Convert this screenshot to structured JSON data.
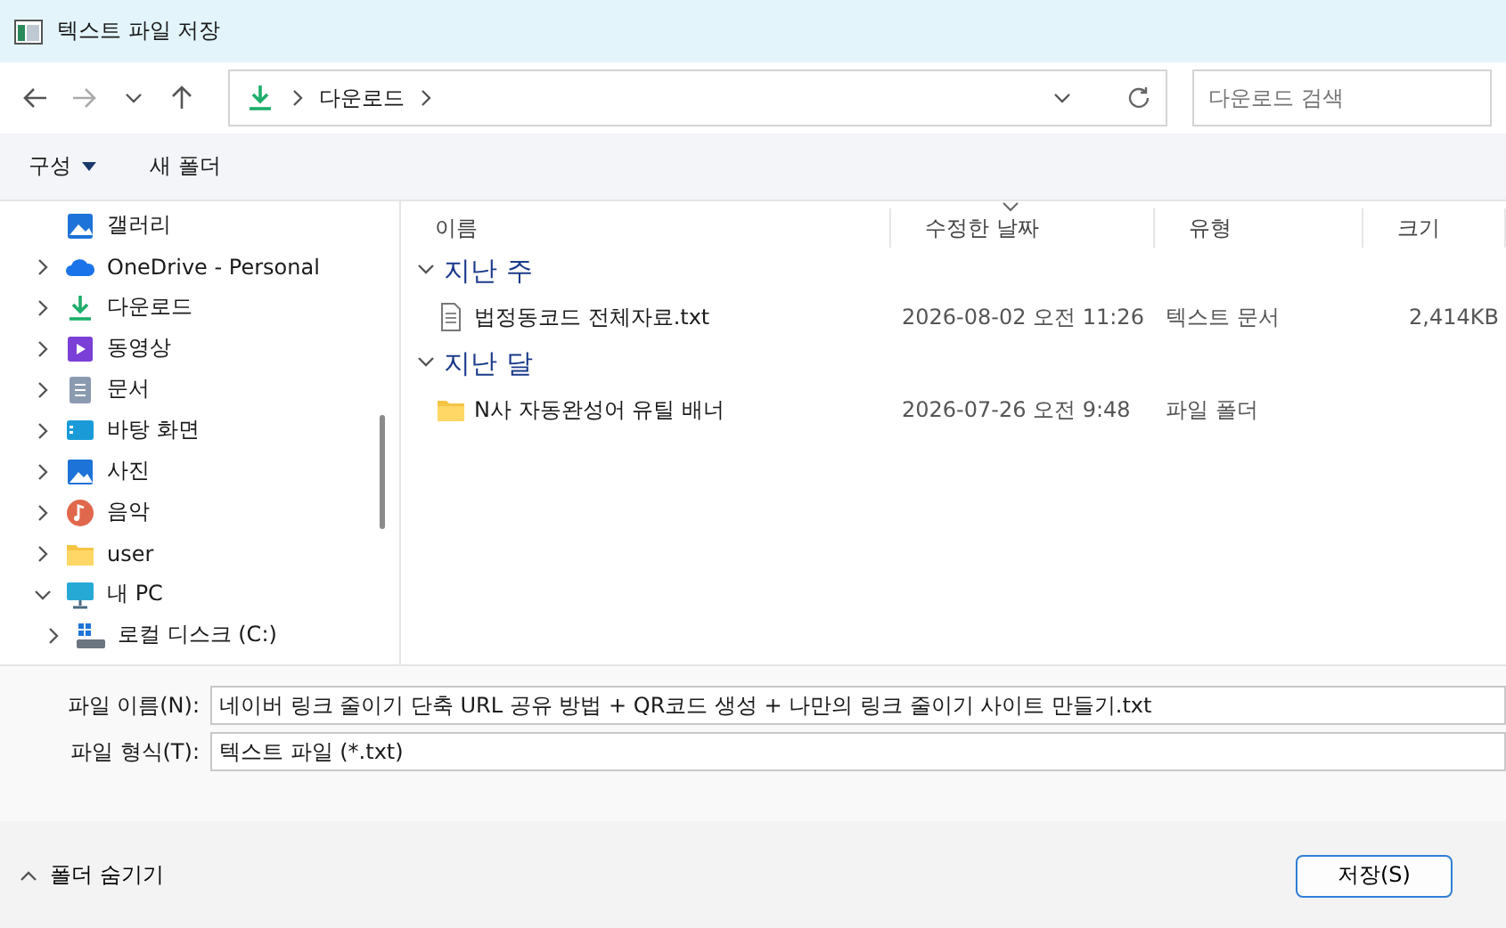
{
  "window": {
    "title": "텍스트 파일 저장"
  },
  "address_bar": {
    "path": [
      "다운로드"
    ]
  },
  "search": {
    "placeholder": "다운로드 검색"
  },
  "command_bar": {
    "organize": "구성",
    "new_folder": "새 폴더"
  },
  "sidebar": {
    "items": [
      {
        "label": "갤러리",
        "kind": "gallery"
      },
      {
        "label": "OneDrive - Personal",
        "kind": "cloud",
        "expanded": false
      },
      {
        "label": "다운로드",
        "kind": "download",
        "expanded": false
      },
      {
        "label": "동영상",
        "kind": "video",
        "expanded": false
      },
      {
        "label": "문서",
        "kind": "document",
        "expanded": false
      },
      {
        "label": "바탕 화면",
        "kind": "desktop",
        "expanded": false
      },
      {
        "label": "사진",
        "kind": "picture",
        "expanded": false
      },
      {
        "label": "음악",
        "kind": "music",
        "expanded": false
      },
      {
        "label": "user",
        "kind": "folder",
        "expanded": false
      },
      {
        "label": "내 PC",
        "kind": "pc",
        "expanded": true,
        "children": [
          {
            "label": "로컬 디스크 (C:)",
            "kind": "drive",
            "expanded": false
          }
        ]
      }
    ]
  },
  "table": {
    "columns": [
      {
        "label": "이름",
        "sorted": false
      },
      {
        "label": "수정한 날짜",
        "sorted": true
      },
      {
        "label": "유형",
        "sorted": false
      },
      {
        "label": "크기",
        "sorted": false
      }
    ],
    "groups": [
      {
        "label": "지난 주",
        "expanded": true,
        "rows": [
          {
            "kind": "file",
            "name": "법정동코드 전체자료.txt",
            "date": "2026-08-02 오전 11:26",
            "type": "텍스트 문서",
            "size": "2,414KB"
          }
        ]
      },
      {
        "label": "지난 달",
        "expanded": true,
        "rows": [
          {
            "kind": "folder",
            "name": "N사 자동완성어 유틸 배너",
            "date": "2026-07-26 오전 9:48",
            "type": "파일 폴더"
          }
        ]
      }
    ]
  },
  "form": {
    "filename_label": "파일 이름(N):",
    "filename": "네이버 링크 줄이기 단축 URL 공유 방법 + QR코드 생성 + 나만의 링크 줄이기 사이트 만들기.txt",
    "filetype_label": "파일 형식(T):",
    "filetype": "텍스트 파일 (*.txt)"
  },
  "footer": {
    "hide_folders": "폴더 숨기기",
    "save_button": "저장(S)"
  }
}
